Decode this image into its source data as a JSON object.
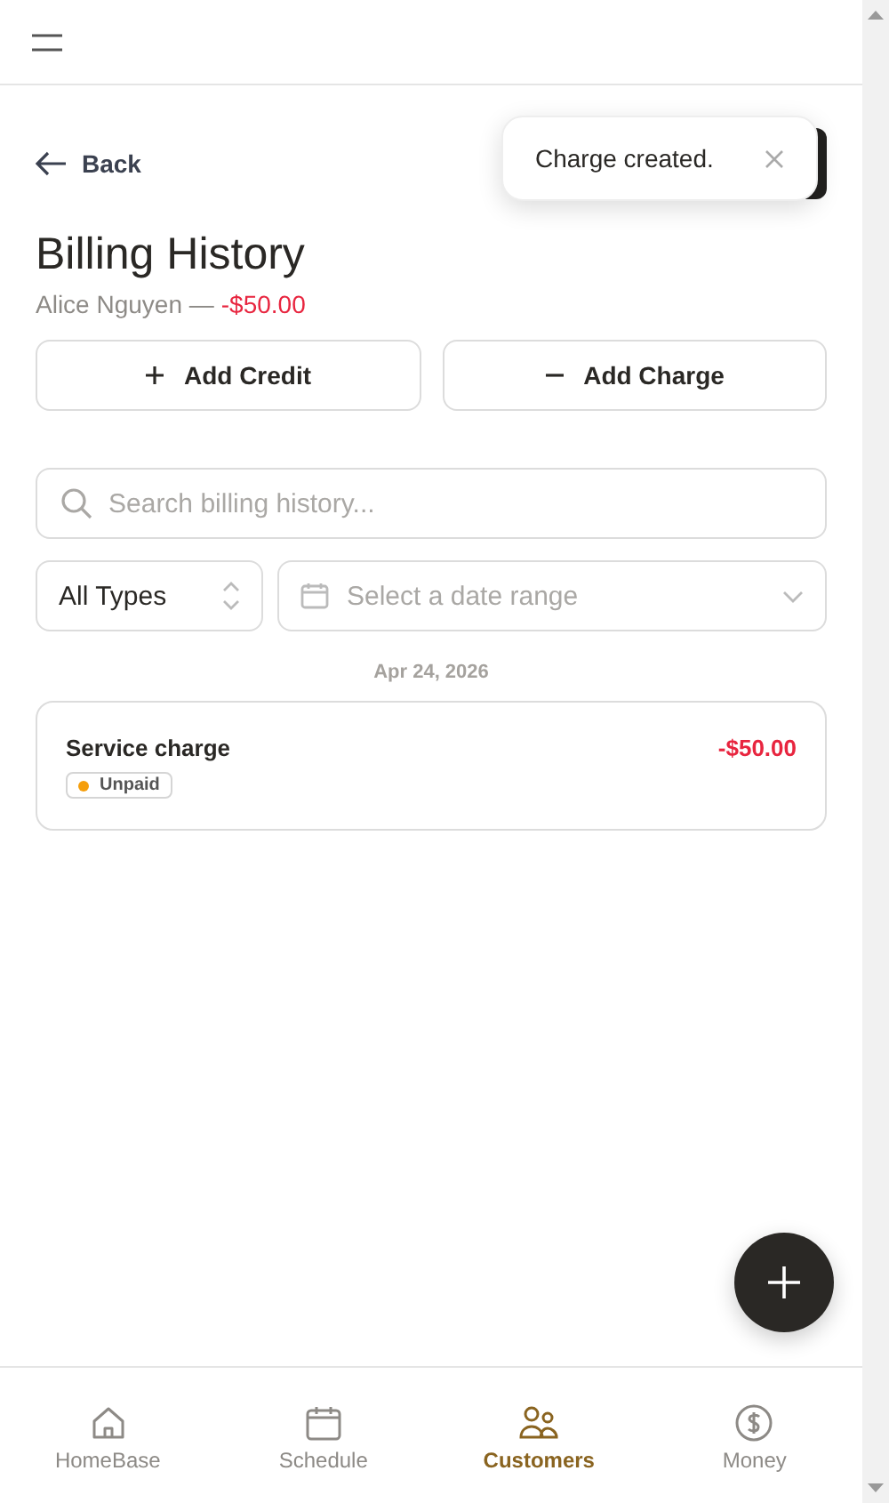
{
  "toast": {
    "message": "Charge created."
  },
  "back": {
    "label": "Back"
  },
  "title": "Billing History",
  "customer": {
    "name": "Alice Nguyen —",
    "balance": "-$50.00"
  },
  "actions": [
    {
      "label": "Add Credit",
      "kind": "plus"
    },
    {
      "label": "Add Charge",
      "kind": "minus"
    }
  ],
  "search": {
    "placeholder": "Search billing history..."
  },
  "type_filter": {
    "value": "All Types"
  },
  "date_filter": {
    "placeholder": "Select a date range"
  },
  "groups": [
    {
      "date": "Apr 24, 2026",
      "items": [
        {
          "title": "Service charge",
          "amount": "-$50.00",
          "status": "Unpaid",
          "color": "#f59e0b"
        }
      ]
    }
  ],
  "nav": [
    {
      "label": "HomeBase",
      "kind": "home",
      "selected": false
    },
    {
      "label": "Schedule",
      "kind": "calendar",
      "selected": false
    },
    {
      "label": "Customers",
      "kind": "people",
      "selected": true
    },
    {
      "label": "Money",
      "kind": "dollar",
      "selected": false
    }
  ]
}
